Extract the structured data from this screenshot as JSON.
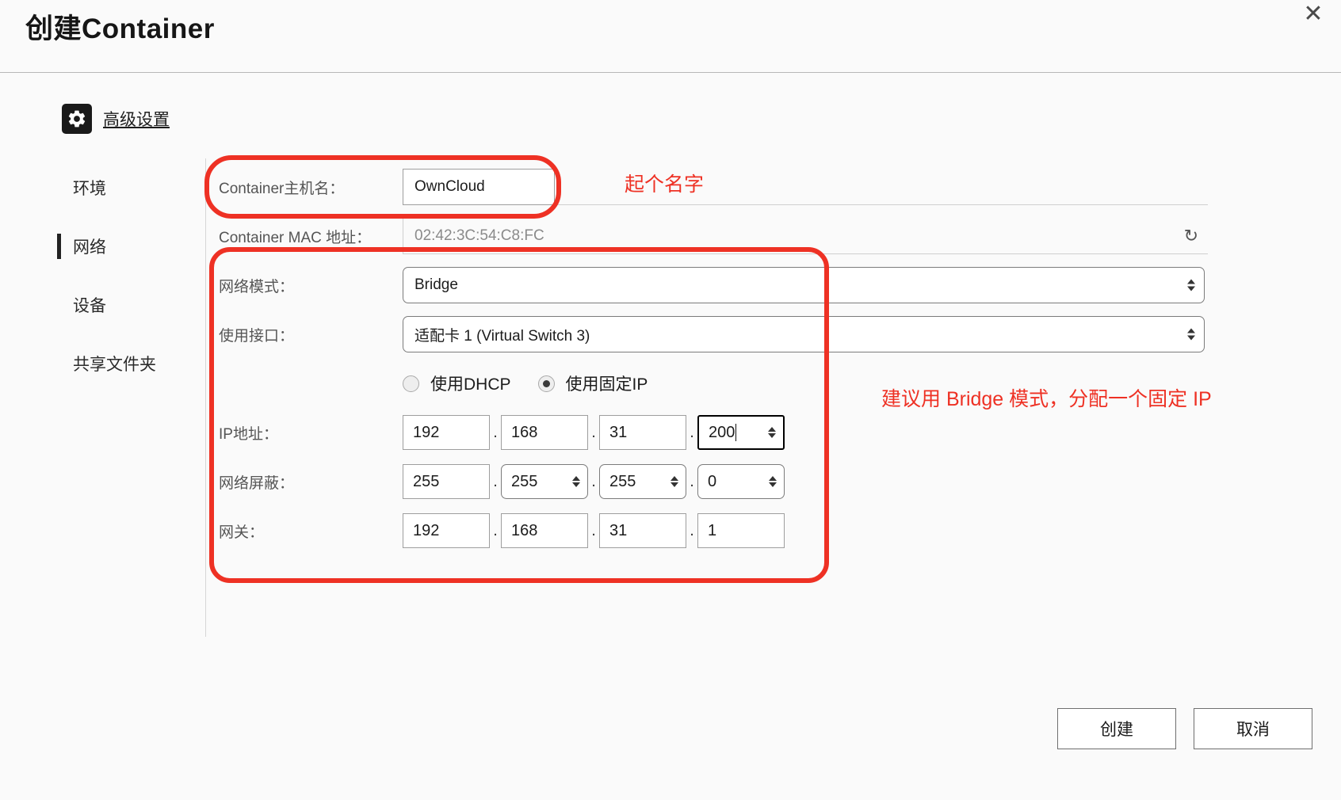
{
  "dialog": {
    "title": "创建Container",
    "close_icon": "close-icon"
  },
  "advanced": {
    "icon": "gear-icon",
    "label": "高级设置"
  },
  "sidebar": {
    "items": [
      {
        "label": "环境",
        "active": false
      },
      {
        "label": "网络",
        "active": true
      },
      {
        "label": "设备",
        "active": false
      },
      {
        "label": "共享文件夹",
        "active": false
      }
    ]
  },
  "form": {
    "hostname": {
      "label": "Container主机名：",
      "value": "OwnCloud"
    },
    "mac": {
      "label": "Container MAC 地址：",
      "value": "02:42:3C:54:C8:FC",
      "refresh_icon": "refresh-icon"
    },
    "network_mode": {
      "label": "网络模式：",
      "value": "Bridge"
    },
    "interface": {
      "label": "使用接口：",
      "value": "适配卡 1 (Virtual Switch 3)"
    },
    "ip_source": {
      "dhcp_label": "使用DHCP",
      "static_label": "使用固定IP",
      "selected": "static"
    },
    "ip_address": {
      "label": "IP地址：",
      "octets": [
        "192",
        "168",
        "31",
        "200"
      ],
      "focused_index": 3
    },
    "netmask": {
      "label": "网络屏蔽：",
      "octets": [
        "255",
        "255",
        "255",
        "0"
      ],
      "spinner_indexes": [
        1,
        2,
        3
      ]
    },
    "gateway": {
      "label": "网关：",
      "octets": [
        "192",
        "168",
        "31",
        "1"
      ]
    }
  },
  "annotations": {
    "name_note": "起个名字",
    "network_note": "建议用 Bridge 模式，分配一个固定 IP",
    "color": "#ee3124"
  },
  "footer": {
    "create_label": "创建",
    "cancel_label": "取消"
  }
}
